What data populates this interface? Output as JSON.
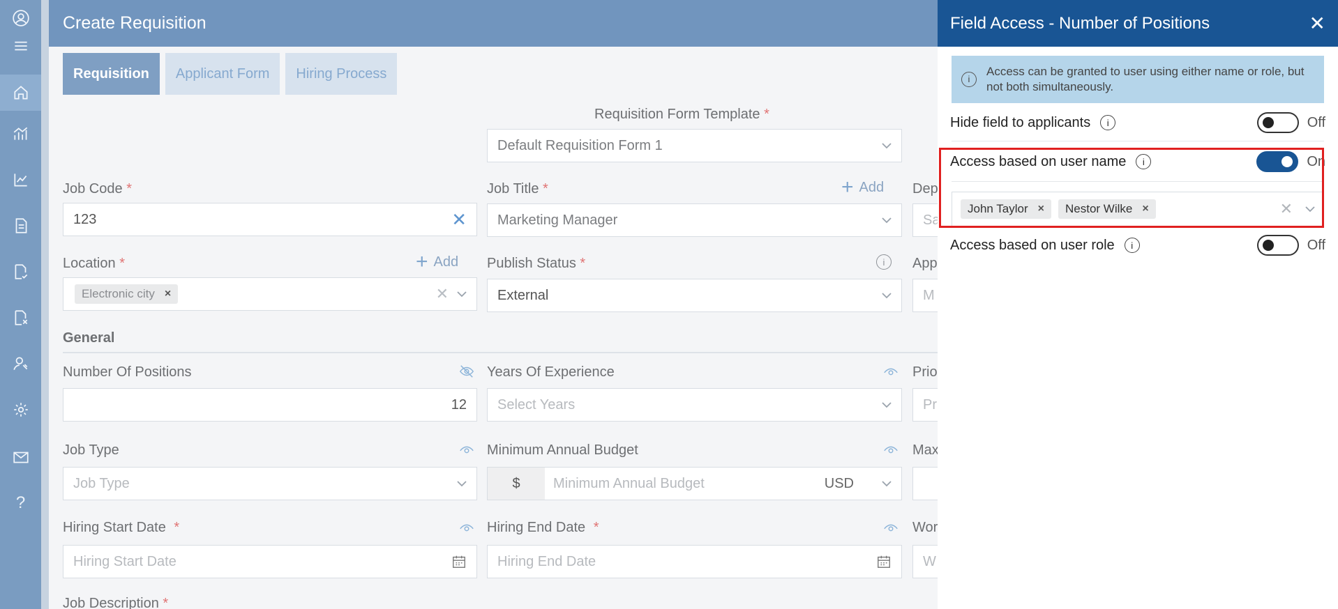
{
  "page": {
    "title": "Create Requisition",
    "tabs": [
      "Requisition",
      "Applicant Form",
      "Hiring Process"
    ],
    "template_label": "Requisition Form Template",
    "template_value": "Default Requisition Form 1",
    "job_code_label": "Job Code",
    "job_code_value": "123",
    "job_title_label": "Job Title",
    "job_title_value": "Marketing Manager",
    "add_label": "Add",
    "dept_label_partial": "Dep",
    "dept_value_partial": "Sa",
    "location_label": "Location",
    "location_chip": "Electronic city",
    "publish_label": "Publish Status",
    "publish_value": "External",
    "app_label_partial": "App",
    "app_value_partial": "M",
    "general_label": "General",
    "positions_label": "Number Of Positions",
    "positions_value": "12",
    "experience_label": "Years Of Experience",
    "experience_placeholder": "Select Years",
    "priority_label_partial": "Prio",
    "priority_placeholder_partial": "Pr",
    "job_type_label": "Job Type",
    "job_type_placeholder": "Job Type",
    "min_budget_label": "Minimum Annual Budget",
    "currency_symbol": "$",
    "min_budget_placeholder": "Minimum Annual Budget",
    "currency_code": "USD",
    "max_label_partial": "Max",
    "start_date_label": "Hiring Start Date",
    "start_date_placeholder": "Hiring Start Date",
    "end_date_label": "Hiring End Date",
    "end_date_placeholder": "Hiring End Date",
    "work_label_partial": "Wor",
    "work_placeholder_partial": "W",
    "job_desc_label": "Job Description",
    "required_mark": "*"
  },
  "panel": {
    "title": "Field Access - Number of Positions",
    "close": "✕",
    "info_text": "Access can be granted to user using either name or role, but not both simultaneously.",
    "rows": [
      {
        "label": "Hide field to applicants",
        "state": "Off"
      },
      {
        "label": "Access based on user name",
        "state": "On"
      },
      {
        "label": "Access based on user role",
        "state": "Off"
      }
    ],
    "users": [
      "John Taylor",
      "Nestor Wilke"
    ]
  },
  "colors": {
    "panel_header": "#195594",
    "main_header": "#7195be",
    "highlight": "#e02020"
  }
}
